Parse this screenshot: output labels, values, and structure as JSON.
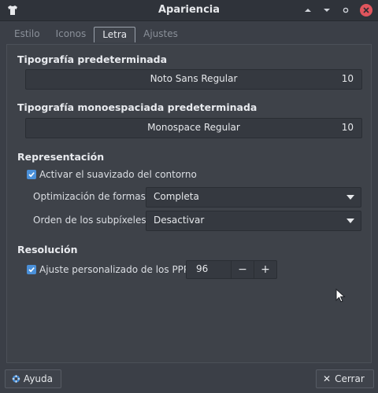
{
  "window": {
    "title": "Apariencia"
  },
  "tabs": [
    {
      "label": "Estilo",
      "active": false
    },
    {
      "label": "Iconos",
      "active": false
    },
    {
      "label": "Letra",
      "active": true
    },
    {
      "label": "Ajustes",
      "active": false
    }
  ],
  "default_font": {
    "heading": "Tipografía predeterminada",
    "name": "Noto Sans Regular",
    "size": "10"
  },
  "mono_font": {
    "heading": "Tipografía monoespaciada predeterminada",
    "name": "Monospace Regular",
    "size": "10"
  },
  "rendering": {
    "heading": "Representación",
    "antialias_label": "Activar el suavizado del contorno",
    "antialias_checked": true,
    "hinting_label": "Optimización de formas:",
    "hinting_value": "Completa",
    "subpixel_label": "Orden de los subpíxeles:",
    "subpixel_value": "Desactivar"
  },
  "resolution": {
    "heading": "Resolución",
    "dpi_label": "Ajuste personalizado de los PPP:",
    "dpi_checked": true,
    "dpi_value": "96",
    "minus": "−",
    "plus": "+"
  },
  "footer": {
    "help_label": "Ayuda",
    "close_label": "Cerrar"
  },
  "colors": {
    "accent": "#4a90d9",
    "close": "#e0555d"
  }
}
